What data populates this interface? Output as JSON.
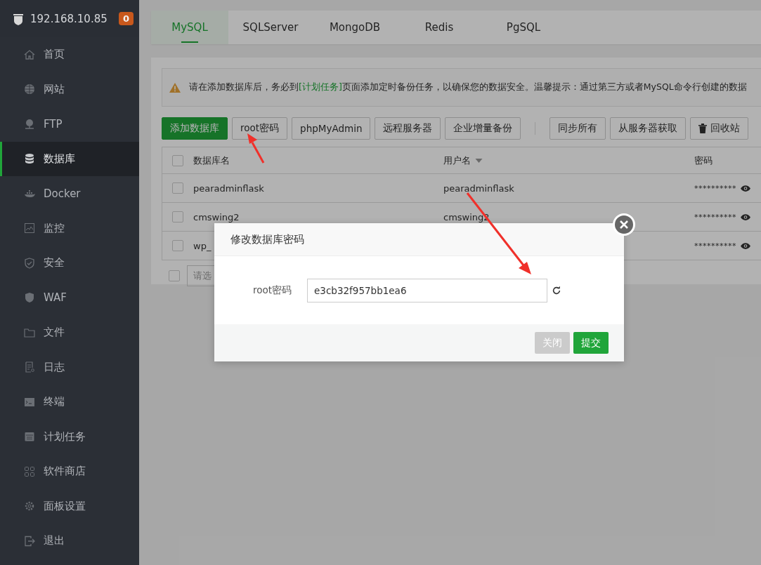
{
  "sidebar": {
    "host": "192.168.10.85",
    "badge": "0",
    "items": [
      {
        "label": "首页",
        "selected": false
      },
      {
        "label": "网站",
        "selected": false
      },
      {
        "label": "FTP",
        "selected": false
      },
      {
        "label": "数据库",
        "selected": true
      },
      {
        "label": "Docker",
        "selected": false
      },
      {
        "label": "监控",
        "selected": false
      },
      {
        "label": "安全",
        "selected": false
      },
      {
        "label": "WAF",
        "selected": false
      },
      {
        "label": "文件",
        "selected": false
      },
      {
        "label": "日志",
        "selected": false
      },
      {
        "label": "终端",
        "selected": false
      },
      {
        "label": "计划任务",
        "selected": false
      },
      {
        "label": "软件商店",
        "selected": false
      },
      {
        "label": "面板设置",
        "selected": false
      },
      {
        "label": "退出",
        "selected": false
      }
    ]
  },
  "tabs": [
    {
      "label": "MySQL",
      "selected": true
    },
    {
      "label": "SQLServer",
      "selected": false
    },
    {
      "label": "MongoDB",
      "selected": false
    },
    {
      "label": "Redis",
      "selected": false
    },
    {
      "label": "PgSQL",
      "selected": false
    }
  ],
  "notice": {
    "before": "请在添加数据库后，务必到",
    "link": "[计划任务]",
    "after": "页面添加定时备份任务，以确保您的数据安全。温馨提示：通过第三方或者MySQL命令行创建的数据"
  },
  "toolbar": {
    "left": [
      {
        "label": "添加数据库",
        "kind": "primary"
      },
      {
        "label": "root密码",
        "kind": "default"
      },
      {
        "label": "phpMyAdmin",
        "kind": "default"
      },
      {
        "label": "远程服务器",
        "kind": "default"
      },
      {
        "label": "企业增量备份",
        "kind": "default"
      }
    ],
    "right": [
      {
        "label": "同步所有",
        "kind": "default"
      },
      {
        "label": "从服务器获取",
        "kind": "default"
      },
      {
        "label": "回收站",
        "kind": "recycle"
      }
    ]
  },
  "table": {
    "header_checked": false,
    "columns": [
      {
        "label": "数据库名",
        "sorted": false
      },
      {
        "label": "用户名",
        "sorted": true
      },
      {
        "label": "密码",
        "sorted": false
      }
    ],
    "rows": [
      {
        "checked": false,
        "name": "pearadminflask",
        "user": "pearadminflask",
        "password": "**********"
      },
      {
        "checked": false,
        "name": "cmswing2",
        "user": "cmswing2",
        "password": "**********"
      },
      {
        "checked": false,
        "name": "wp_",
        "password": "**********"
      }
    ]
  },
  "batch": {
    "checked": false,
    "placeholder": "请选"
  },
  "dialog": {
    "title": "修改数据库密码",
    "field_label": "root密码",
    "value": "e3cb32f957bb1ea6",
    "buttons": [
      {
        "label": "关闭",
        "kind": "disabled"
      },
      {
        "label": "提交",
        "kind": "primary"
      }
    ]
  }
}
